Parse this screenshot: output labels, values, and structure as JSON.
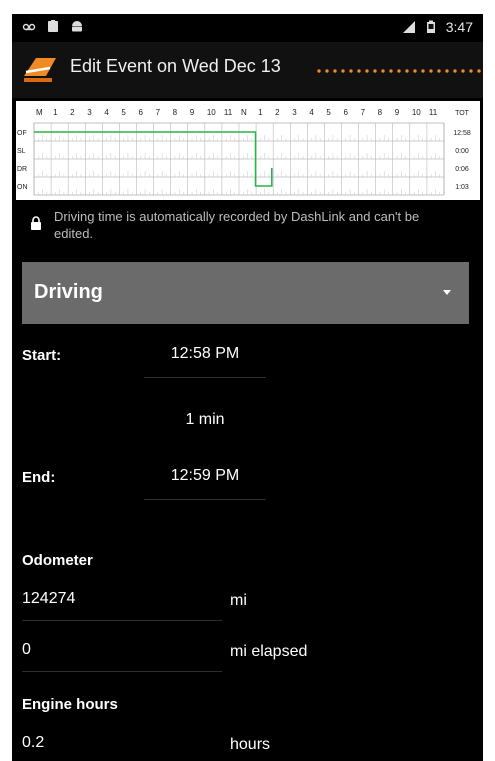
{
  "statusbar": {
    "left_icons": [
      "voicemail-icon",
      "clipboard-icon",
      "android-icon"
    ],
    "right_icons": [
      "signal-icon",
      "battery-icon"
    ],
    "time": "3:47"
  },
  "header": {
    "title": "Edit Event on Wed Dec 13",
    "logo": "dashlink-logo"
  },
  "log_graph": {
    "hours": [
      "M",
      "1",
      "2",
      "3",
      "4",
      "5",
      "6",
      "7",
      "8",
      "9",
      "10",
      "11",
      "N",
      "1",
      "2",
      "3",
      "4",
      "5",
      "6",
      "7",
      "8",
      "9",
      "10",
      "11"
    ],
    "total_label": "TOT",
    "rows": [
      {
        "label": "OF",
        "total": "12:58"
      },
      {
        "label": "SL",
        "total": "0:00"
      },
      {
        "label": "DR",
        "total": "0:06"
      },
      {
        "label": "ON",
        "total": "1:03"
      }
    ],
    "line_color": "#2bb24c"
  },
  "notice": {
    "text": "Driving time is automatically recorded by DashLink and can't be edited."
  },
  "status": {
    "selected": "Driving"
  },
  "start": {
    "label": "Start:",
    "value": "12:58 PM"
  },
  "duration": "1 min",
  "end": {
    "label": "End:",
    "value": "12:59 PM"
  },
  "odometer": {
    "heading": "Odometer",
    "value": "124274",
    "unit": "mi",
    "elapsed_value": "0",
    "elapsed_unit": "mi elapsed"
  },
  "engine_hours": {
    "heading": "Engine hours",
    "value": "0.2",
    "unit": "hours"
  },
  "colors": {
    "background": "#000000",
    "dropdown": "#6b6b6b",
    "annotation_dots": "#f08a24",
    "graph_line": "#2bb24c"
  }
}
